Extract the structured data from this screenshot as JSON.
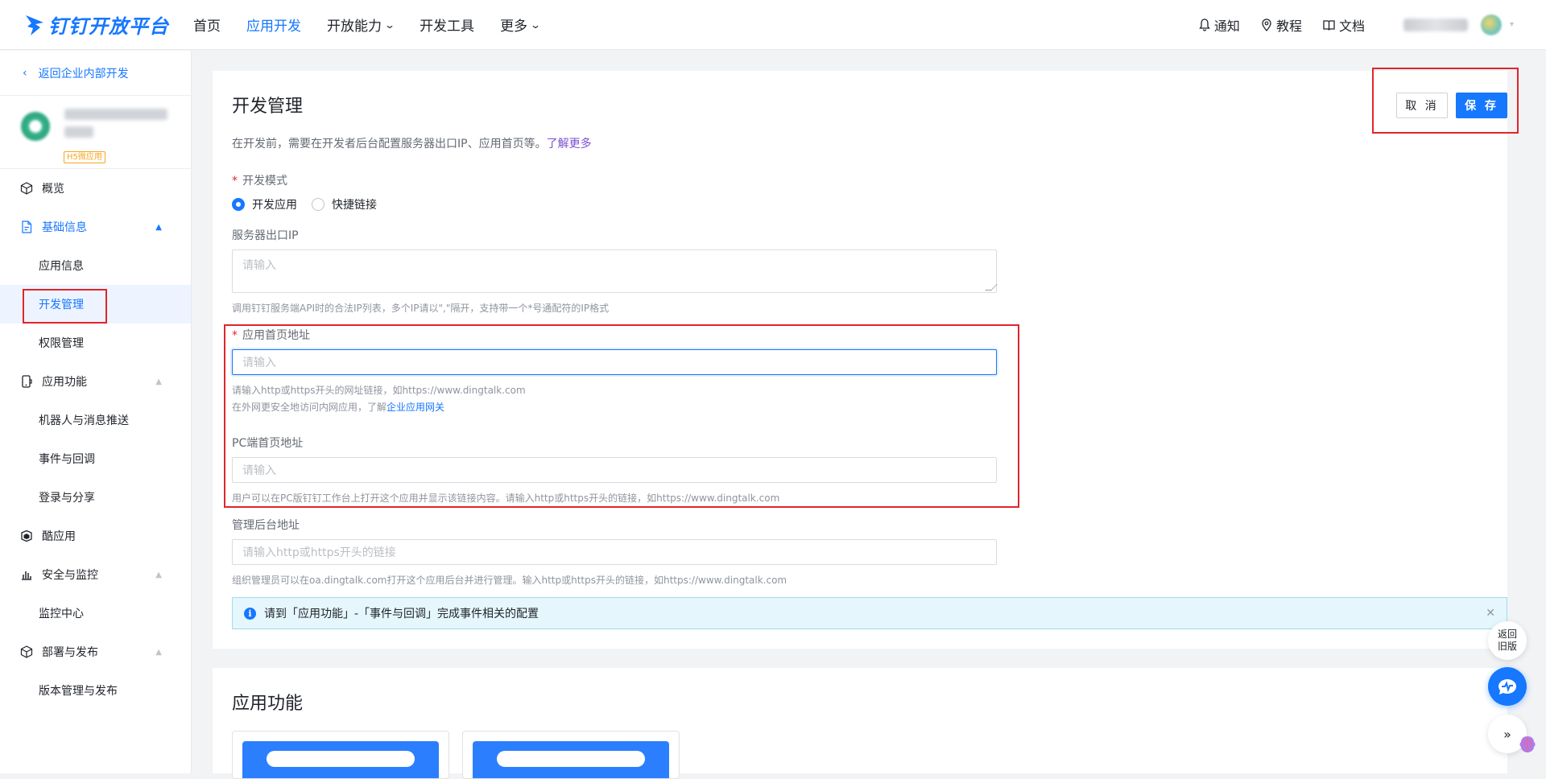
{
  "header": {
    "logo_text": "钉钉开放平台",
    "nav": [
      {
        "label": "首页",
        "has_dropdown": false
      },
      {
        "label": "应用开发",
        "has_dropdown": false,
        "active": true
      },
      {
        "label": "开放能力",
        "has_dropdown": true
      },
      {
        "label": "开发工具",
        "has_dropdown": false
      },
      {
        "label": "更多",
        "has_dropdown": true
      }
    ],
    "right": {
      "notify": "通知",
      "tutorial": "教程",
      "docs": "文档"
    }
  },
  "sidebar": {
    "back_link": "返回企业内部开发",
    "app_badge": "H5微应用",
    "menu": [
      {
        "type": "group",
        "label": "概览",
        "icon": "cube-icon"
      },
      {
        "type": "group",
        "label": "基础信息",
        "icon": "document-icon",
        "active": true,
        "expanded": true
      },
      {
        "type": "sub",
        "label": "应用信息"
      },
      {
        "type": "sub",
        "label": "开发管理",
        "active": true
      },
      {
        "type": "sub",
        "label": "权限管理"
      },
      {
        "type": "group",
        "label": "应用功能",
        "icon": "mobile-icon",
        "expanded": true
      },
      {
        "type": "sub",
        "label": "机器人与消息推送"
      },
      {
        "type": "sub",
        "label": "事件与回调"
      },
      {
        "type": "sub",
        "label": "登录与分享"
      },
      {
        "type": "group",
        "label": "酷应用",
        "icon": "cool-app-icon"
      },
      {
        "type": "group",
        "label": "安全与监控",
        "icon": "bar-chart-icon",
        "expanded": true
      },
      {
        "type": "sub",
        "label": "监控中心"
      },
      {
        "type": "group",
        "label": "部署与发布",
        "icon": "package-icon",
        "expanded": true
      },
      {
        "type": "sub",
        "label": "版本管理与发布"
      }
    ]
  },
  "main": {
    "title": "开发管理",
    "description": "在开发前，需要在开发者后台配置服务器出口IP、应用首页等。",
    "learn_more": "了解更多",
    "cancel": "取 消",
    "save": "保 存",
    "dev_mode": {
      "label": "开发模式",
      "options": [
        "开发应用",
        "快捷链接"
      ],
      "selected": "开发应用"
    },
    "server_ip": {
      "label": "服务器出口IP",
      "placeholder": "请输入",
      "hint": "调用钉钉服务端API时的合法IP列表，多个IP请以\",\"隔开，支持带一个*号通配符的IP格式"
    },
    "homepage": {
      "label": "应用首页地址",
      "placeholder": "请输入",
      "hint1": "请输入http或https开头的网址链接，如https://www.dingtalk.com",
      "hint2_prefix": "在外网更安全地访问内网应用，了解",
      "hint2_link": "企业应用网关"
    },
    "pc_homepage": {
      "label": "PC端首页地址",
      "placeholder": "请输入",
      "hint": "用户可以在PC版钉钉工作台上打开这个应用并显示该链接内容。请输入http或https开头的链接，如https://www.dingtalk.com"
    },
    "admin_url": {
      "label": "管理后台地址",
      "placeholder": "请输入http或https开头的链接",
      "hint": "组织管理员可以在oa.dingtalk.com打开这个应用后台并进行管理。输入http或https开头的链接，如https://www.dingtalk.com"
    },
    "alert": "请到「应用功能」-「事件与回调」完成事件相关的配置"
  },
  "section2": {
    "title": "应用功能"
  },
  "floating": {
    "old_version": "返回\n旧版"
  },
  "colors": {
    "accent": "#1677ff",
    "highlight_box": "#e0252b"
  }
}
